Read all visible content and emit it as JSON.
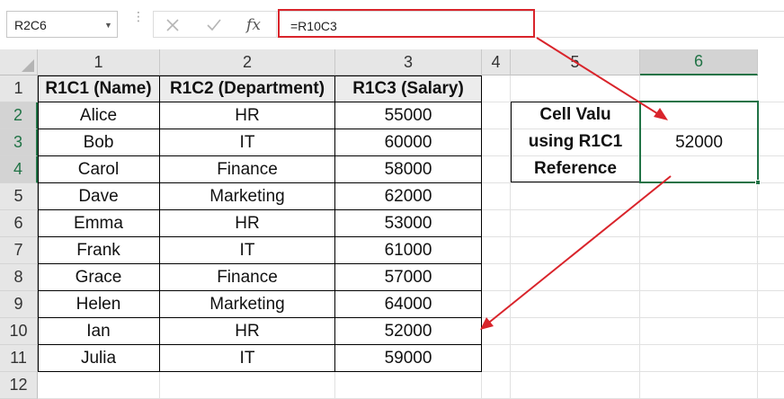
{
  "name_box": {
    "value": "R2C6"
  },
  "formula_bar": {
    "fx_label": "fx",
    "formula": "=R10C3"
  },
  "columns": [
    "1",
    "2",
    "3",
    "4",
    "5",
    "6"
  ],
  "rows": [
    "1",
    "2",
    "3",
    "4",
    "5",
    "6",
    "7",
    "8",
    "9",
    "10",
    "11",
    "12"
  ],
  "table": {
    "headers": [
      "R1C1 (Name)",
      "R1C2 (Department)",
      "R1C3 (Salary)"
    ],
    "rows": [
      [
        "Alice",
        "HR",
        "55000"
      ],
      [
        "Bob",
        "IT",
        "60000"
      ],
      [
        "Carol",
        "Finance",
        "58000"
      ],
      [
        "Dave",
        "Marketing",
        "62000"
      ],
      [
        "Emma",
        "HR",
        "53000"
      ],
      [
        "Frank",
        "IT",
        "61000"
      ],
      [
        "Grace",
        "Finance",
        "57000"
      ],
      [
        "Helen",
        "Marketing",
        "64000"
      ],
      [
        "Ian",
        "HR",
        "52000"
      ],
      [
        "Julia",
        "IT",
        "59000"
      ]
    ]
  },
  "lookup": {
    "label_lines": [
      "Cell Valu",
      "using R1C1",
      "Reference"
    ],
    "value": "52000"
  },
  "colors": {
    "accent_green": "#217346",
    "annotation_red": "#d9242b"
  }
}
